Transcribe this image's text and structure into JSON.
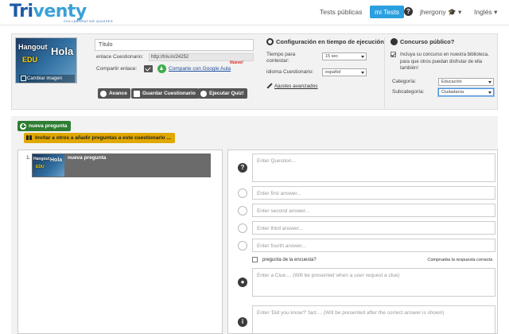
{
  "header": {
    "logo_text_a": "Tri",
    "logo_text_b": "venty",
    "logo_tagline": "COLLABORATIVE QUIZZES",
    "nav_public_tests": "Tests públicas",
    "nav_my_tests": "mi Tests",
    "help_label": "?",
    "username": "jhergony",
    "language": "Inglés"
  },
  "quiz": {
    "image_overlay_1": "Hangout",
    "image_overlay_2": "Hola",
    "image_overlay_3": "EDU",
    "change_image_label": "Cambiar imagen",
    "title_placeholder": "Título",
    "link_label": "enlace Cuestionario:",
    "link_value": "http://triv.in/24252",
    "share_label": "Compartir enlace:",
    "share_google": "Comparte con Google Aula",
    "new_badge": "Nuevo!",
    "buttons": {
      "preview": "Avance",
      "save": "Guardar Cuestionario",
      "run": "Ejecutar Quiz!"
    }
  },
  "runtime": {
    "heading": "Configuración en tiempo de ejecución",
    "time_label": "Tiempo para contestar:",
    "time_value": "15 sec",
    "language_label": "idioma Cuestionario:",
    "language_value": "español",
    "advanced_link": "Ajustes avanzados"
  },
  "contest": {
    "heading": "Concurso público?",
    "include_text": "Incluya su concurso en nuestra biblioteca, para que otros puedan disfrutar de ella también!",
    "include_checked": true,
    "category_label": "Categoría:",
    "category_value": "Educación",
    "subcategory_label": "Subcategoría:",
    "subcategory_value": "Ciudadanía"
  },
  "toolbar": {
    "new_question": "nueva pregunta",
    "invite": "Invitar a otros a añadir preguntas a este cuestionario ..."
  },
  "questions": [
    {
      "number": "1.",
      "label": "nueva pregunta"
    }
  ],
  "editor": {
    "question_placeholder": "Enter Question...",
    "answers": [
      "Enter first answer...",
      "Enter second answer...",
      "Enter third answer...",
      "Enter fourth answer..."
    ],
    "survey_label": "pregunta de la encuesta?",
    "check_correct": "Comprueba la respuesta correcta",
    "clue_placeholder": "Enter a Clue.... (Will be presented when a user request a clue)",
    "fact_placeholder": "Enter 'Did you know?' fact.... (Will be presented after the correct answer is shown)"
  },
  "colors": {
    "brand_blue": "#1e5aa8",
    "accent_blue": "#2b9fe0",
    "green": "#2e7d32",
    "yellow": "#e0a800"
  }
}
